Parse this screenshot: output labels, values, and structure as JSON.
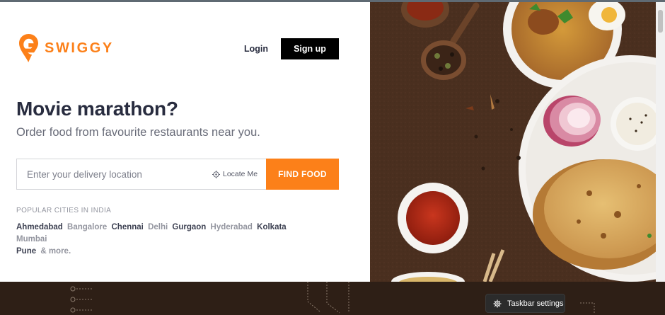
{
  "brand": {
    "name": "SWIGGY",
    "color": "#fc8019"
  },
  "nav": {
    "login": "Login",
    "signup": "Sign up"
  },
  "hero": {
    "headline": "Movie marathon?",
    "subheadline": "Order food from favourite restaurants near you."
  },
  "search": {
    "placeholder": "Enter your delivery location",
    "locate_label": "Locate Me",
    "find_label": "FIND FOOD"
  },
  "popular": {
    "heading": "POPULAR CITIES IN INDIA",
    "cities": [
      {
        "name": "Ahmedabad",
        "tone": "dark"
      },
      {
        "name": "Bangalore",
        "tone": "light"
      },
      {
        "name": "Chennai",
        "tone": "dark"
      },
      {
        "name": "Delhi",
        "tone": "light"
      },
      {
        "name": "Gurgaon",
        "tone": "dark"
      },
      {
        "name": "Hyderabad",
        "tone": "light"
      },
      {
        "name": "Kolkata",
        "tone": "dark"
      },
      {
        "name": "Mumbai",
        "tone": "light"
      },
      {
        "name": "Pune",
        "tone": "dark"
      },
      {
        "name": "& more.",
        "tone": "light"
      }
    ]
  },
  "taskbar": {
    "settings_label": "Taskbar settings",
    "icon": "gear-icon"
  },
  "colors": {
    "accent": "#fc8019",
    "text_dark": "#282c3f",
    "text_muted": "#686b78",
    "food_bg": "#4a2f1f"
  }
}
